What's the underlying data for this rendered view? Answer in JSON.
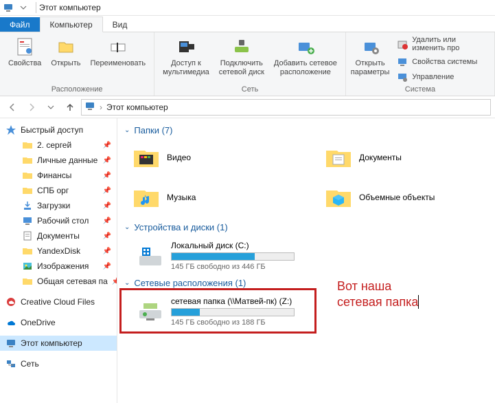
{
  "window": {
    "title": "Этот компьютер"
  },
  "tabs": {
    "file": "Файл",
    "computer": "Компьютер",
    "view": "Вид"
  },
  "ribbon": {
    "group1": {
      "label": "Расположение",
      "properties": "Свойства",
      "open": "Открыть",
      "rename": "Переименовать"
    },
    "group2": {
      "label": "Сеть",
      "media": "Доступ к\nмультимедиа",
      "map": "Подключить\nсетевой диск",
      "addnet": "Добавить сетевое\nрасположение"
    },
    "group3": {
      "label": "Система",
      "settings": "Открыть\nпараметры",
      "uninstall": "Удалить или изменить про",
      "sysprops": "Свойства системы",
      "manage": "Управление"
    }
  },
  "nav": {
    "crumb1": "Этот компьютер"
  },
  "sidebar": {
    "quick": "Быстрый доступ",
    "items": [
      "2. сергей",
      "Личные данные",
      "Финансы",
      "СПБ орг",
      "Загрузки",
      "Рабочий стол",
      "Документы",
      "YandexDisk",
      "Изображения",
      "Общая сетевая па"
    ],
    "ccf": "Creative Cloud Files",
    "onedrive": "OneDrive",
    "thispc": "Этот компьютер",
    "network": "Сеть"
  },
  "sections": {
    "folders": {
      "title": "Папки (7)",
      "items": [
        "Видео",
        "Документы",
        "Музыка",
        "Объемные объекты"
      ]
    },
    "drives": {
      "title": "Устройства и диски (1)",
      "local": {
        "name": "Локальный диск (C:)",
        "free": "145 ГБ свободно из 446 ГБ",
        "pct": 68
      }
    },
    "netloc": {
      "title": "Сетевые расположения (1)",
      "share": {
        "name": "сетевая папка (\\\\Матвей-пк) (Z:)",
        "free": "145 ГБ свободно из 188 ГБ",
        "pct": 23
      }
    }
  },
  "annotation": {
    "line1": "Вот наша",
    "line2": "сетевая папка"
  }
}
